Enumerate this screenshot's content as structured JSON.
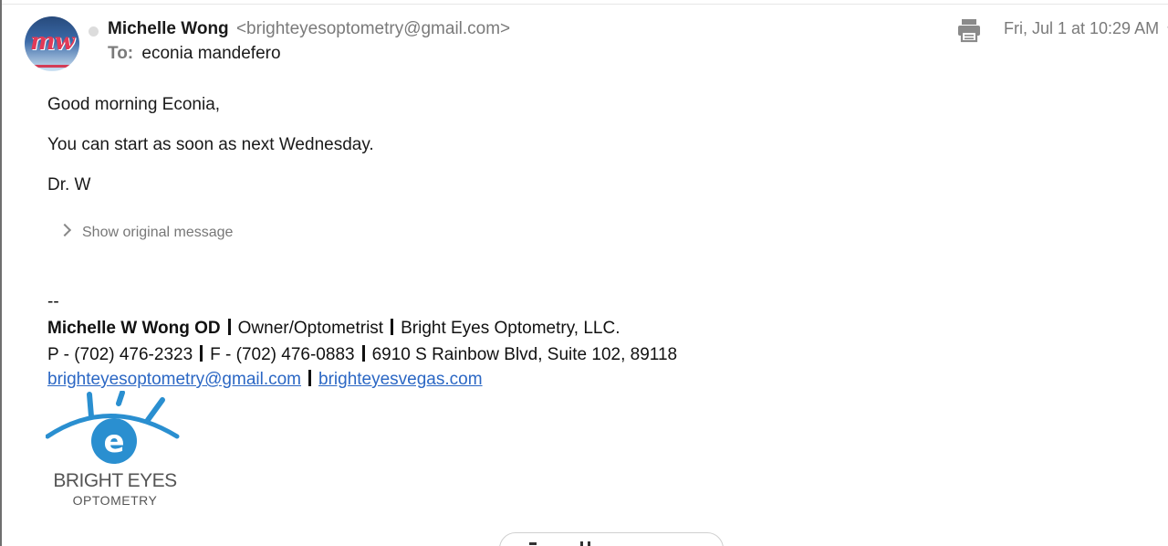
{
  "header": {
    "avatar_monogram": "mw",
    "sender_name": "Michelle Wong",
    "sender_email": "<brighteyesoptometry@gmail.com>",
    "to_label": "To:",
    "recipient": "econia mandefero",
    "datetime": "Fri, Jul 1 at 10:29 AM",
    "print_icon": "printer-icon"
  },
  "body": {
    "greeting": "Good morning Econia,",
    "message": "You can start as soon as next Wednesday.",
    "signoff": "Dr. W",
    "show_original": "Show original message"
  },
  "signature": {
    "dashes": "--",
    "name": "Michelle W Wong OD",
    "title": "Owner/Optometrist",
    "company": "Bright Eyes Optometry, LLC.",
    "phone": "P - (702) 476-2323",
    "fax": "F - (702) 476-0883",
    "address": "6910 S Rainbow Blvd, Suite 102, 89118",
    "email_link": "brighteyesoptometry@gmail.com",
    "website_link": "brighteyesvegas.com"
  },
  "logo": {
    "letter": "e",
    "title": "BRIGHT EYES",
    "subtitle": "OPTOMETRY",
    "color": "#2a8fd0"
  },
  "colors": {
    "link": "#2b67c4",
    "muted": "#7a7a7a"
  }
}
